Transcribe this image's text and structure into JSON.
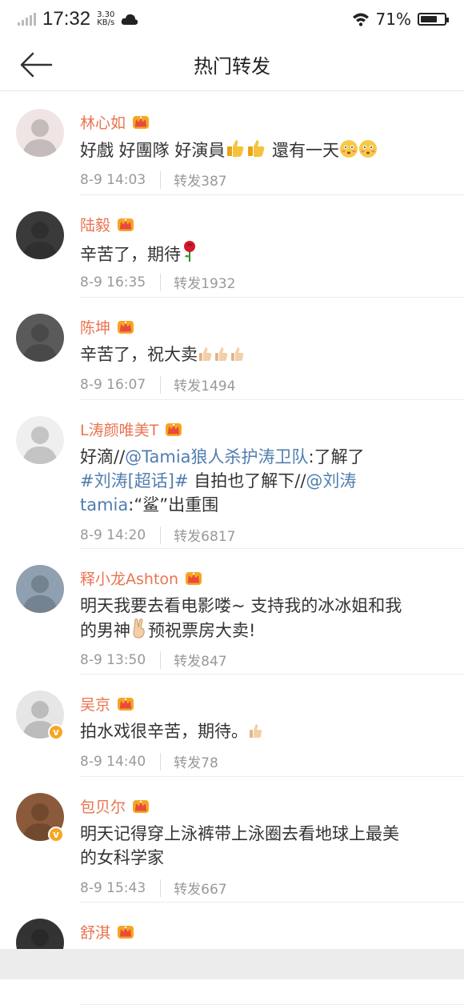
{
  "status_bar": {
    "time": "17:32",
    "speed_value": "3.30",
    "speed_unit": "KB/s",
    "battery_percent": "71%",
    "battery_level": 0.71
  },
  "nav": {
    "title": "热门转发"
  },
  "items": [
    {
      "name": "林心如",
      "content": [
        {
          "t": "好戲 好團隊 好演員"
        },
        {
          "emoji": "thumbs-up"
        },
        {
          "emoji": "thumbs-up"
        },
        {
          "t": " 還有一天"
        },
        {
          "emoji": "flushed-face"
        },
        {
          "emoji": "flushed-face"
        }
      ],
      "date": "8-9 14:03",
      "repost": "转发387",
      "verified": false,
      "avatar_color": "#f0e4e4"
    },
    {
      "name": "陆毅",
      "content": [
        {
          "t": "辛苦了，期待"
        },
        {
          "emoji": "rose"
        }
      ],
      "date": "8-9 16:35",
      "repost": "转发1932",
      "verified": false,
      "avatar_color": "#3a3a3a"
    },
    {
      "name": "陈坤",
      "content": [
        {
          "t": "辛苦了，祝大卖"
        },
        {
          "emoji": "thumbs-up-small"
        },
        {
          "emoji": "thumbs-up-small"
        },
        {
          "emoji": "thumbs-up-small"
        }
      ],
      "date": "8-9 16:07",
      "repost": "转发1494",
      "verified": false,
      "avatar_color": "#5a5a5a"
    },
    {
      "name": "L涛颜唯美T",
      "content_lines": [
        [
          {
            "t": "好滴//"
          },
          {
            "hl": "@Tamia狼人杀护涛卫队"
          },
          {
            "t": ":了解了"
          }
        ],
        [
          {
            "hl": "#刘涛[超话]#"
          },
          {
            "t": " 自拍也了解下//"
          },
          {
            "hl": "@刘涛"
          }
        ],
        [
          {
            "hl": "tamia"
          },
          {
            "t": ":“鲨”出重围"
          }
        ]
      ],
      "date": "8-9 14:20",
      "repost": "转发6817",
      "verified": false,
      "avatar_color": "#efefef"
    },
    {
      "name": "释小龙Ashton",
      "content_lines": [
        [
          {
            "t": "明天我要去看电影喽~ 支持我的冰冰姐和我"
          }
        ],
        [
          {
            "t": "的男神"
          },
          {
            "emoji": "victory-hand"
          },
          {
            "t": "预祝票房大卖!"
          }
        ]
      ],
      "date": "8-9 13:50",
      "repost": "转发847",
      "verified": false,
      "avatar_color": "#8fa0b0"
    },
    {
      "name": "吴京",
      "content": [
        {
          "t": "拍水戏很辛苦，期待。"
        },
        {
          "emoji": "thumbs-up-small"
        }
      ],
      "date": "8-9 14:40",
      "repost": "转发78",
      "verified": true,
      "avatar_color": "#e6e6e6"
    },
    {
      "name": "包贝尔",
      "content_lines": [
        [
          {
            "t": "明天记得穿上泳裤带上泳圈去看地球上最美"
          }
        ],
        [
          {
            "t": "的女科学家"
          }
        ]
      ],
      "date": "8-9 15:43",
      "repost": "转发667",
      "verified": true,
      "avatar_color": "#8a5a3a"
    },
    {
      "name": "舒淇",
      "content": [],
      "date": "",
      "repost": "",
      "verified": false,
      "avatar_color": "#333333"
    }
  ],
  "colors": {
    "name": "#eb7350",
    "link": "#507daf",
    "meta": "#999999",
    "crown": "#f5a623"
  }
}
